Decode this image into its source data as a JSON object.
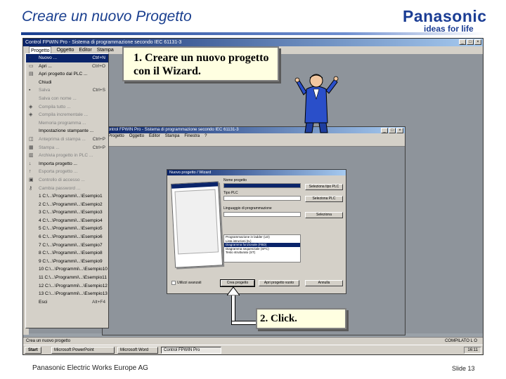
{
  "slide": {
    "title": "Creare un nuovo Progetto",
    "brand": "Panasonic",
    "tagline": "ideas for life",
    "footer_left": "Panasonic Electric Works Europe AG",
    "footer_right": "Slide 13"
  },
  "app": {
    "title": "Control FPWIN Pro - Sistema di programmazione secondo IEC 61131-3",
    "menu": [
      "Progetto",
      "Oggetto",
      "Editor",
      "Stampa"
    ],
    "status_left": "Crea un nuovo progetto",
    "status_right": "COMPILATO L O"
  },
  "file_menu": {
    "items": [
      {
        "label": "Nuovo ...",
        "shortcut": "Ctrl+N",
        "icon": "new-file-icon",
        "state": "selected"
      },
      {
        "label": "Apri ...",
        "shortcut": "Ctrl+O",
        "icon": "open-folder-icon",
        "state": "normal"
      },
      {
        "label": "Apri progetto dal PLC ...",
        "shortcut": "",
        "icon": "plc-icon",
        "state": "normal"
      },
      {
        "label": "Chiudi",
        "shortcut": "",
        "icon": "",
        "state": "normal"
      },
      {
        "label": "Salva",
        "shortcut": "Ctrl+S",
        "icon": "save-icon",
        "state": "disabled"
      },
      {
        "label": "Salva con nome ...",
        "shortcut": "",
        "icon": "",
        "state": "disabled"
      },
      {
        "label": "Compila tutto ...",
        "shortcut": "",
        "icon": "compile-icon",
        "state": "disabled"
      },
      {
        "label": "Compila incrementale ...",
        "shortcut": "",
        "icon": "compile-icon",
        "state": "disabled"
      },
      {
        "label": "Memoria programma ...",
        "shortcut": "",
        "icon": "",
        "state": "disabled"
      },
      {
        "label": "Impostazione stampante ...",
        "shortcut": "",
        "icon": "",
        "state": "normal"
      },
      {
        "label": "Anteprima di stampa ...",
        "shortcut": "Ctrl+P",
        "icon": "preview-icon",
        "state": "disabled"
      },
      {
        "label": "Stampa ...",
        "shortcut": "Ctrl+P",
        "icon": "printer-icon",
        "state": "disabled"
      },
      {
        "label": "Archivia progetto in PLC ...",
        "shortcut": "",
        "icon": "archive-icon",
        "state": "disabled"
      },
      {
        "label": "Importa progetto ...",
        "shortcut": "",
        "icon": "import-icon",
        "state": "normal"
      },
      {
        "label": "Esporta progetto ...",
        "shortcut": "",
        "icon": "export-icon",
        "state": "disabled"
      },
      {
        "label": "Controllo di accesso ...",
        "shortcut": "",
        "icon": "lock-icon",
        "state": "disabled"
      },
      {
        "label": "Cambia password ...",
        "shortcut": "",
        "icon": "key-icon",
        "state": "disabled"
      },
      {
        "label": "1 C:\\...\\Programmi\\...\\Esempio1",
        "shortcut": "",
        "icon": "",
        "state": "normal"
      },
      {
        "label": "2 C:\\...\\Programmi\\...\\Esempio2",
        "shortcut": "",
        "icon": "",
        "state": "normal"
      },
      {
        "label": "3 C:\\...\\Programmi\\...\\Esempio3",
        "shortcut": "",
        "icon": "",
        "state": "normal"
      },
      {
        "label": "4 C:\\...\\Programmi\\...\\Esempio4",
        "shortcut": "",
        "icon": "",
        "state": "normal"
      },
      {
        "label": "5 C:\\...\\Programmi\\...\\Esempio5",
        "shortcut": "",
        "icon": "",
        "state": "normal"
      },
      {
        "label": "6 C:\\...\\Programmi\\...\\Esempio6",
        "shortcut": "",
        "icon": "",
        "state": "normal"
      },
      {
        "label": "7 C:\\...\\Programmi\\...\\Esempio7",
        "shortcut": "",
        "icon": "",
        "state": "normal"
      },
      {
        "label": "8 C:\\...\\Programmi\\...\\Esempio8",
        "shortcut": "",
        "icon": "",
        "state": "normal"
      },
      {
        "label": "9 C:\\...\\Programmi\\...\\Esempio9",
        "shortcut": "",
        "icon": "",
        "state": "normal"
      },
      {
        "label": "10 C:\\...\\Programmi\\...\\Esempio10",
        "shortcut": "",
        "icon": "",
        "state": "normal"
      },
      {
        "label": "11 C:\\...\\Programmi\\...\\Esempio11",
        "shortcut": "",
        "icon": "",
        "state": "normal"
      },
      {
        "label": "12 C:\\...\\Programmi\\...\\Esempio12",
        "shortcut": "",
        "icon": "",
        "state": "normal"
      },
      {
        "label": "13 C:\\...\\Programmi\\...\\Esempio13",
        "shortcut": "",
        "icon": "",
        "state": "normal"
      },
      {
        "label": "Esci",
        "shortcut": "Alt+F4",
        "icon": "",
        "state": "normal"
      }
    ]
  },
  "window2": {
    "title": "Control FPWIN Pro - Sistema di programmazione secondo IEC 61131-3",
    "menu": [
      "Progetto",
      "Oggetto",
      "Editor",
      "Stampa",
      "Finestra",
      "?"
    ]
  },
  "dialog": {
    "title": "Nuovo progetto / Wizard",
    "label_project": "Nome progetto",
    "value_project": "Progetto1",
    "label_type": "Tipo PLC",
    "label_lang": "Linguaggio di programmazione",
    "btn_select_plc": "Seleziona tipo PLC",
    "btn_select_lang": "Seleziona PLC",
    "btn_select_type": "Seleziona",
    "list": [
      "Programmazione in ladder (LD)",
      "Lista istruzioni (IL)",
      "Diagramma funzionale (FBD)",
      "Diagramma sequenziale (SFC)",
      "Testo strutturato (ST)"
    ],
    "list_selected": 2,
    "checkbox_label": "Utilizzi avanzati",
    "btn_create": "Crea progetto",
    "btn_open": "Apri progetto vuoto",
    "btn_cancel": "Annulla"
  },
  "callouts": {
    "step1": "1. Creare un nuovo progetto con il Wizard.",
    "step2": "2. Click."
  },
  "taskbar": {
    "start": "Start",
    "items": [
      "Microsoft PowerPoint",
      "Microsoft Word",
      "Control FPWIN Pro"
    ],
    "clock": "16:11"
  },
  "colors": {
    "title_blue": "#1a3f8f",
    "titlebar_start": "#0a246a",
    "titlebar_end": "#a6caf0",
    "window_face": "#d4d0c8",
    "callout_bg": "#ffffe1"
  }
}
